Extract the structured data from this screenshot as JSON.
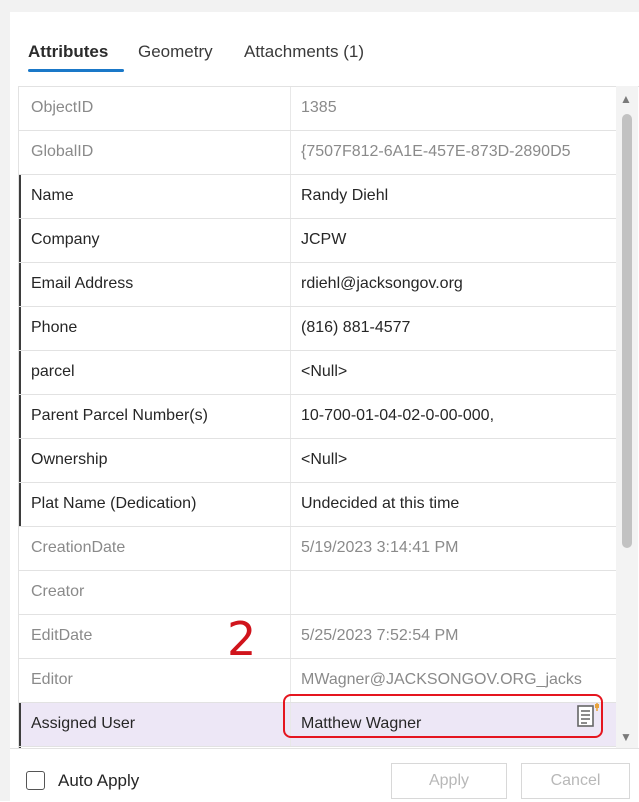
{
  "tabs": [
    {
      "label": "Attributes",
      "active": true
    },
    {
      "label": "Geometry",
      "active": false
    },
    {
      "label": "Attachments (1)",
      "active": false
    }
  ],
  "rows": [
    {
      "name": "ObjectID",
      "value": "1385",
      "readonly": true
    },
    {
      "name": "GlobalID",
      "value": "{7507F812-6A1E-457E-873D-2890D5",
      "readonly": true
    },
    {
      "name": "Name",
      "value": "Randy Diehl",
      "readonly": false
    },
    {
      "name": "Company",
      "value": "JCPW",
      "readonly": false
    },
    {
      "name": "Email Address",
      "value": "rdiehl@jacksongov.org",
      "readonly": false
    },
    {
      "name": "Phone",
      "value": "(816) 881-4577",
      "readonly": false
    },
    {
      "name": "parcel",
      "value": "<Null>",
      "readonly": false
    },
    {
      "name": "Parent Parcel Number(s)",
      "value": "10-700-01-04-02-0-00-000,",
      "readonly": false
    },
    {
      "name": "Ownership",
      "value": "<Null>",
      "readonly": false
    },
    {
      "name": "Plat Name (Dedication)",
      "value": "Undecided at this time",
      "readonly": false
    },
    {
      "name": "CreationDate",
      "value": "5/19/2023 3:14:41 PM",
      "readonly": true
    },
    {
      "name": "Creator",
      "value": "",
      "readonly": true
    },
    {
      "name": "EditDate",
      "value": "5/25/2023 7:52:54 PM",
      "readonly": true
    },
    {
      "name": "Editor",
      "value": "MWagner@JACKSONGOV.ORG_jacks",
      "readonly": true
    },
    {
      "name": "Assigned User",
      "value": "Matthew Wagner",
      "readonly": false,
      "selected": true
    }
  ],
  "annotation": "2",
  "footer": {
    "auto_apply_label": "Auto Apply",
    "auto_apply_checked": false,
    "apply_label": "Apply",
    "cancel_label": "Cancel"
  },
  "colors": {
    "accent": "#1a78c8",
    "highlight": "#e5151f",
    "selected_row": "#ede7f6"
  },
  "icons": {
    "scroll_up": "chevron-up-icon",
    "scroll_down": "chevron-down-icon",
    "edit": "edit-field-icon"
  }
}
